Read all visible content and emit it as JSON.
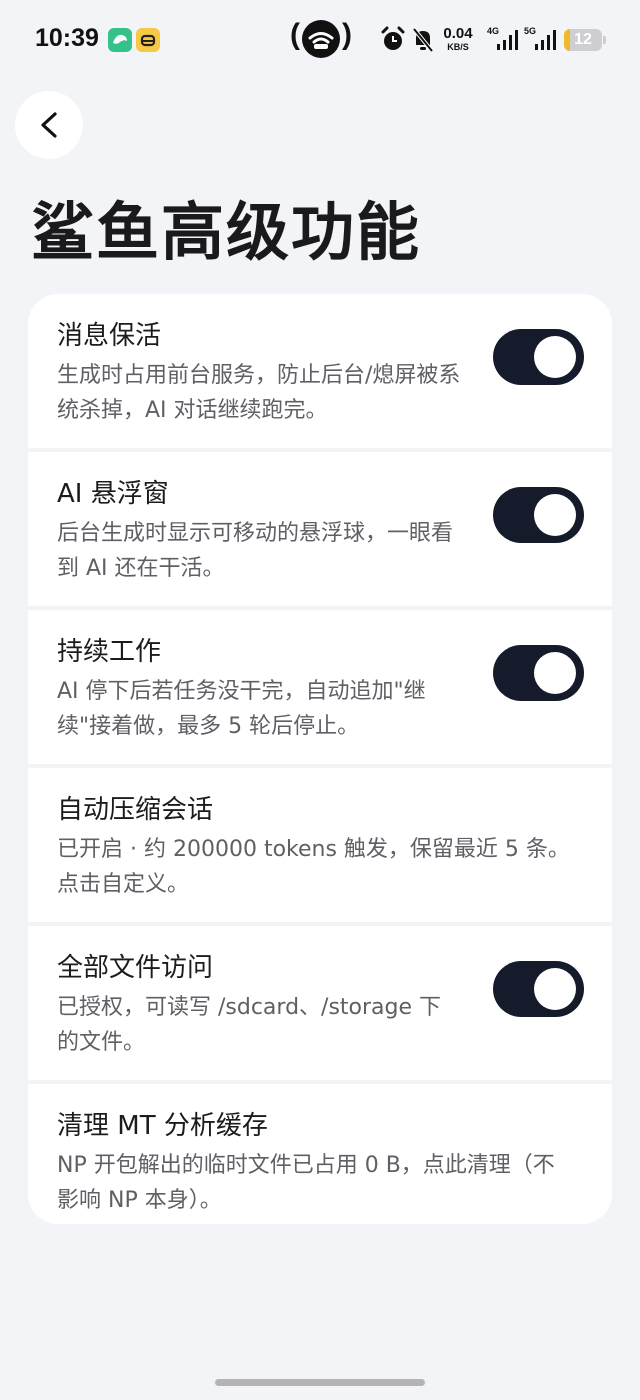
{
  "status_bar": {
    "time": "10:39",
    "net_speed_value": "0.04",
    "net_speed_unit": "KB/S",
    "net1_label": "4G",
    "net2_label": "5G",
    "battery_level": "12",
    "icons": [
      "app-green-icon",
      "app-yellow-icon",
      "hotspot-icon",
      "alarm-icon",
      "bell-off-icon",
      "signal-icon",
      "signal-icon",
      "battery-icon"
    ]
  },
  "header": {
    "back_icon": "chevron-left-icon",
    "title": "鲨鱼高级功能"
  },
  "settings": [
    {
      "title": "消息保活",
      "description": "生成时占用前台服务，防止后台/熄屏被系统杀掉，AI 对话继续跑完。",
      "has_toggle": true,
      "enabled": true
    },
    {
      "title": "AI 悬浮窗",
      "description": "后台生成时显示可移动的悬浮球，一眼看到 AI 还在干活。",
      "has_toggle": true,
      "enabled": true
    },
    {
      "title": "持续工作",
      "description": "AI 停下后若任务没干完，自动追加\"继续\"接着做，最多 5 轮后停止。",
      "has_toggle": true,
      "enabled": true
    },
    {
      "title": "自动压缩会话",
      "description": "已开启 · 约 200000 tokens 触发，保留最近 5 条。点击自定义。",
      "has_toggle": false
    },
    {
      "title": "全部文件访问",
      "description": "已授权，可读写 /sdcard、/storage 下的文件。",
      "has_toggle": true,
      "enabled": true
    },
    {
      "title": "清理 MT 分析缓存",
      "description": "NP 开包解出的临时文件已占用 0 B，点此清理（不影响 NP 本身）。",
      "has_toggle": false
    }
  ],
  "colors": {
    "background": "#f3f4f8",
    "card": "#ffffff",
    "toggle_on": "#161b2c",
    "description_text": "#5f6066"
  }
}
